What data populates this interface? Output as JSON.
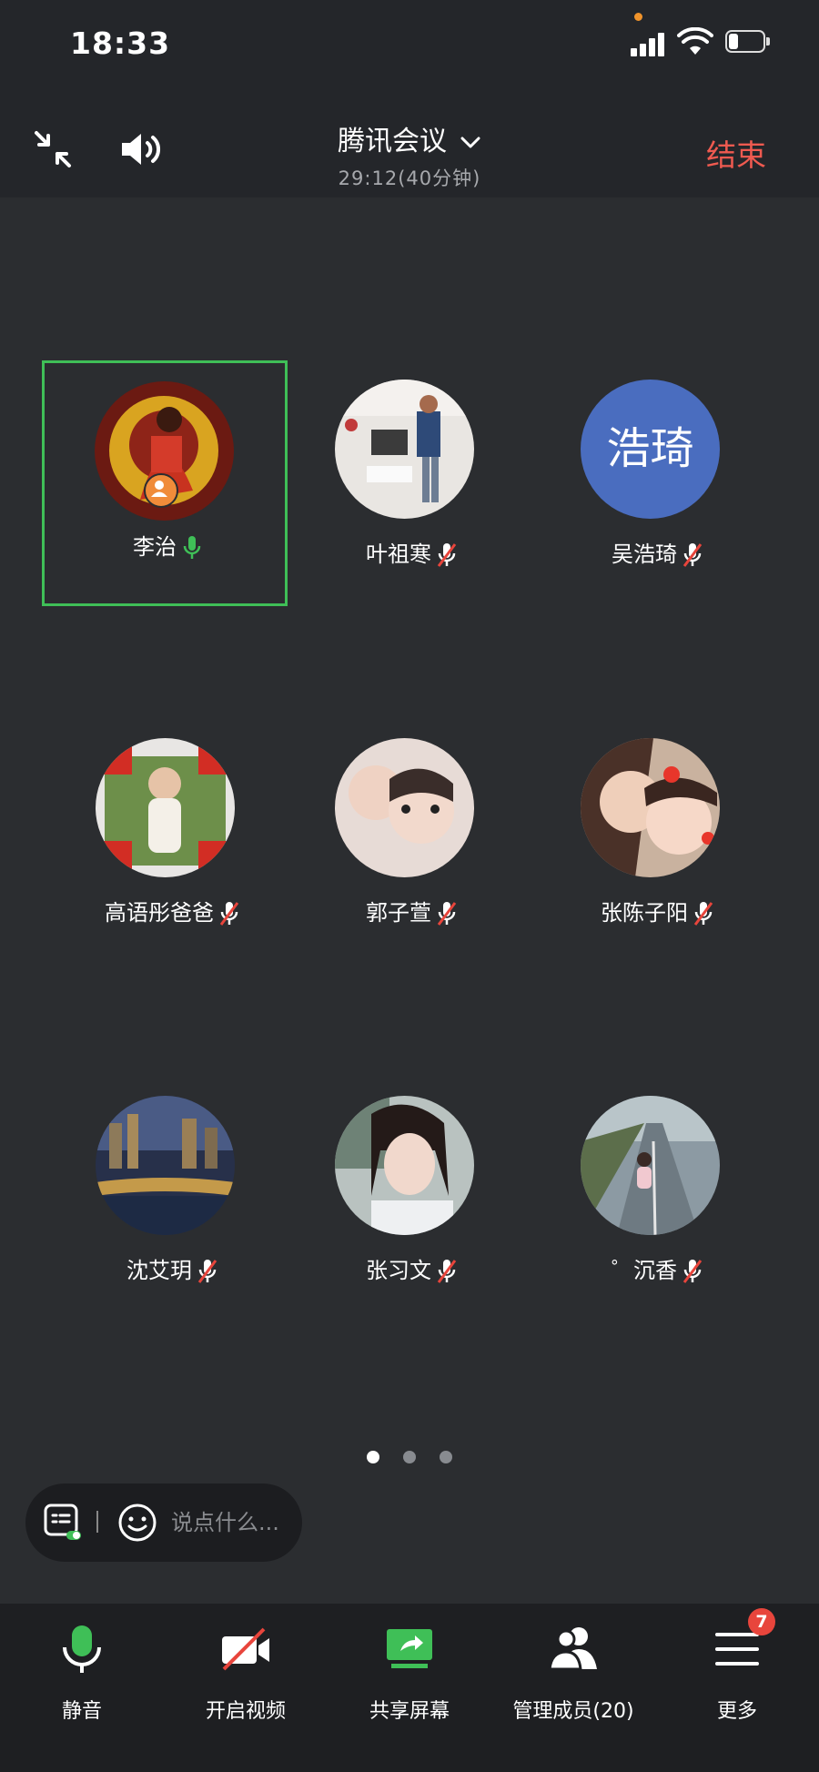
{
  "status_bar": {
    "time": "18:33"
  },
  "header": {
    "title": "腾讯会议",
    "timer": "29:12(40分钟)",
    "end_label": "结束"
  },
  "participants": [
    {
      "name": "李治",
      "mic": "on",
      "active": true,
      "host": true
    },
    {
      "name": "叶祖寒",
      "mic": "muted"
    },
    {
      "name": "吴浩琦",
      "mic": "muted",
      "avatar_text": "浩琦",
      "avatar_color": "#4a6dbf"
    },
    {
      "name": "高语彤爸爸",
      "mic": "muted"
    },
    {
      "name": "郭子萱",
      "mic": "muted"
    },
    {
      "name": "张陈子阳",
      "mic": "muted"
    },
    {
      "name": "沈艾玥",
      "mic": "muted"
    },
    {
      "name": "张习文",
      "mic": "muted"
    },
    {
      "name": "゜沉香",
      "mic": "muted"
    }
  ],
  "pager": {
    "total": 3,
    "current": 1
  },
  "chat": {
    "placeholder": "说点什么..."
  },
  "toolbar": {
    "mute_label": "静音",
    "video_label": "开启视频",
    "share_label": "共享屏幕",
    "members_label": "管理成员(20)",
    "more_label": "更多",
    "more_badge": "7"
  },
  "colors": {
    "accent_green": "#3fbf57",
    "end_red": "#ef5a50",
    "badge_red": "#e8453c",
    "host_orange": "#f08c3a"
  }
}
